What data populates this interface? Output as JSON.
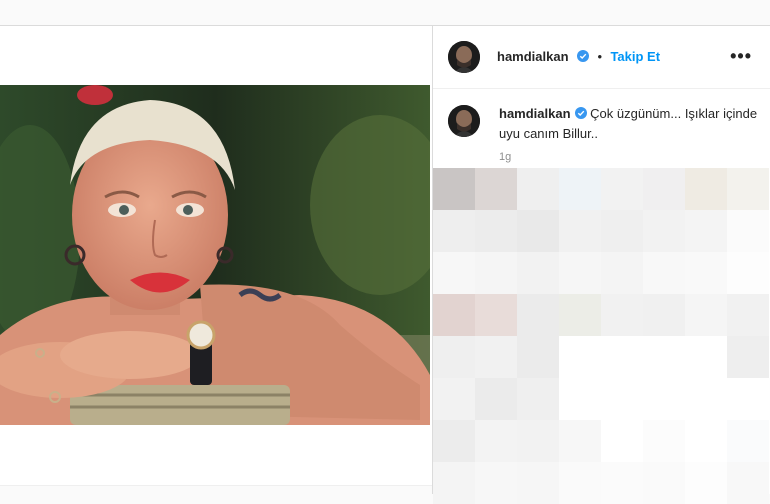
{
  "post": {
    "username": "hamdialkan",
    "separator": "•",
    "follow_label": "Takip Et",
    "more_label": "•••",
    "caption_username": "hamdialkan",
    "caption_text": "Çok üzgünüm... Işıklar içinde uyu canım Billur..",
    "time_ago": "1g"
  },
  "icons": {
    "verified": "verified-badge-icon",
    "more": "more-options-icon"
  },
  "colors": {
    "accent": "#0095f6",
    "verified": "#3897f0",
    "lipstick": "#d8323a"
  }
}
